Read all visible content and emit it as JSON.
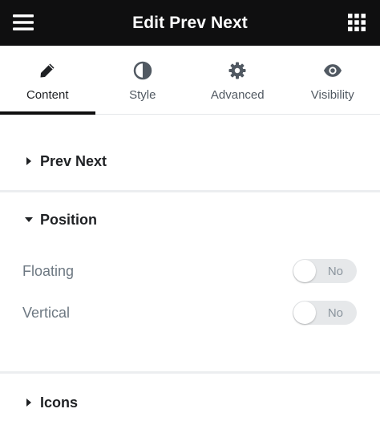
{
  "header": {
    "title": "Edit Prev Next",
    "menu_icon": "hamburger-menu-icon",
    "grid_icon": "apps-grid-icon"
  },
  "tabs": [
    {
      "label": "Content",
      "icon": "pencil-icon",
      "active": true
    },
    {
      "label": "Style",
      "icon": "half-circle-icon",
      "active": false
    },
    {
      "label": "Advanced",
      "icon": "gear-icon",
      "active": false
    },
    {
      "label": "Visibility",
      "icon": "eye-icon",
      "active": false
    }
  ],
  "sections": {
    "prev_next": {
      "label": "Prev Next",
      "expanded": false
    },
    "position": {
      "label": "Position",
      "expanded": true,
      "controls": [
        {
          "label": "Floating",
          "switch_text": "No",
          "value": false
        },
        {
          "label": "Vertical",
          "switch_text": "No",
          "value": false
        }
      ]
    },
    "icons": {
      "label": "Icons",
      "expanded": false
    }
  },
  "colors": {
    "header_bg": "#0f0f10",
    "active_tab_indicator": "#0f0f10",
    "switch_bg": "#e6e8ea",
    "label_text": "#6d7882"
  }
}
